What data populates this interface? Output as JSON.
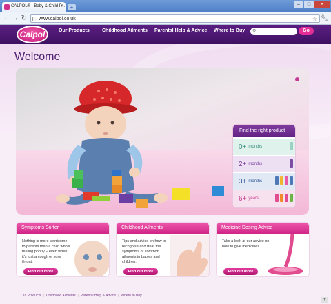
{
  "browser": {
    "tab_title": "CALPOL® - Baby & Child P...",
    "tab_close": "×",
    "new_tab": "+",
    "address": "www.calpol.co.uk",
    "minimize": "–",
    "maximize": "□",
    "close": "✕"
  },
  "site": {
    "logo": "Calpol",
    "nav": [
      "Our Products",
      "Childhood Ailments",
      "Parental Help & Advice",
      "Where to Buy"
    ],
    "search_placeholder": "",
    "go_label": "Go",
    "welcome": "Welcome"
  },
  "finder": {
    "title": "Find the right product",
    "rows": [
      {
        "age": "0+",
        "unit": "months"
      },
      {
        "age": "2+",
        "unit": "months"
      },
      {
        "age": "3+",
        "unit": "months"
      },
      {
        "age": "6+",
        "unit": "years"
      }
    ]
  },
  "promos": [
    {
      "title": "Symptoms Sorter",
      "text": "Nothing is more worrisome to parents than a child who's feeling poorly – even when it's just a cough or sore throat.",
      "button": "Find out more"
    },
    {
      "title": "Childhood Ailments",
      "text": "Tips and advice on how to recognise and treat the symptoms of common ailments in babies and children.",
      "button": "Find out more"
    },
    {
      "title": "Medicine Dosing Advice",
      "text": "Take a look at our advice on how to give medicines.",
      "button": "Find out more"
    }
  ],
  "footer": [
    "Our Products",
    "Childhood Ailments",
    "Parental Help & Advice",
    "Where to Buy"
  ],
  "colors": {
    "brand_purple": "#4a1d6e",
    "brand_pink": "#e22e95"
  }
}
